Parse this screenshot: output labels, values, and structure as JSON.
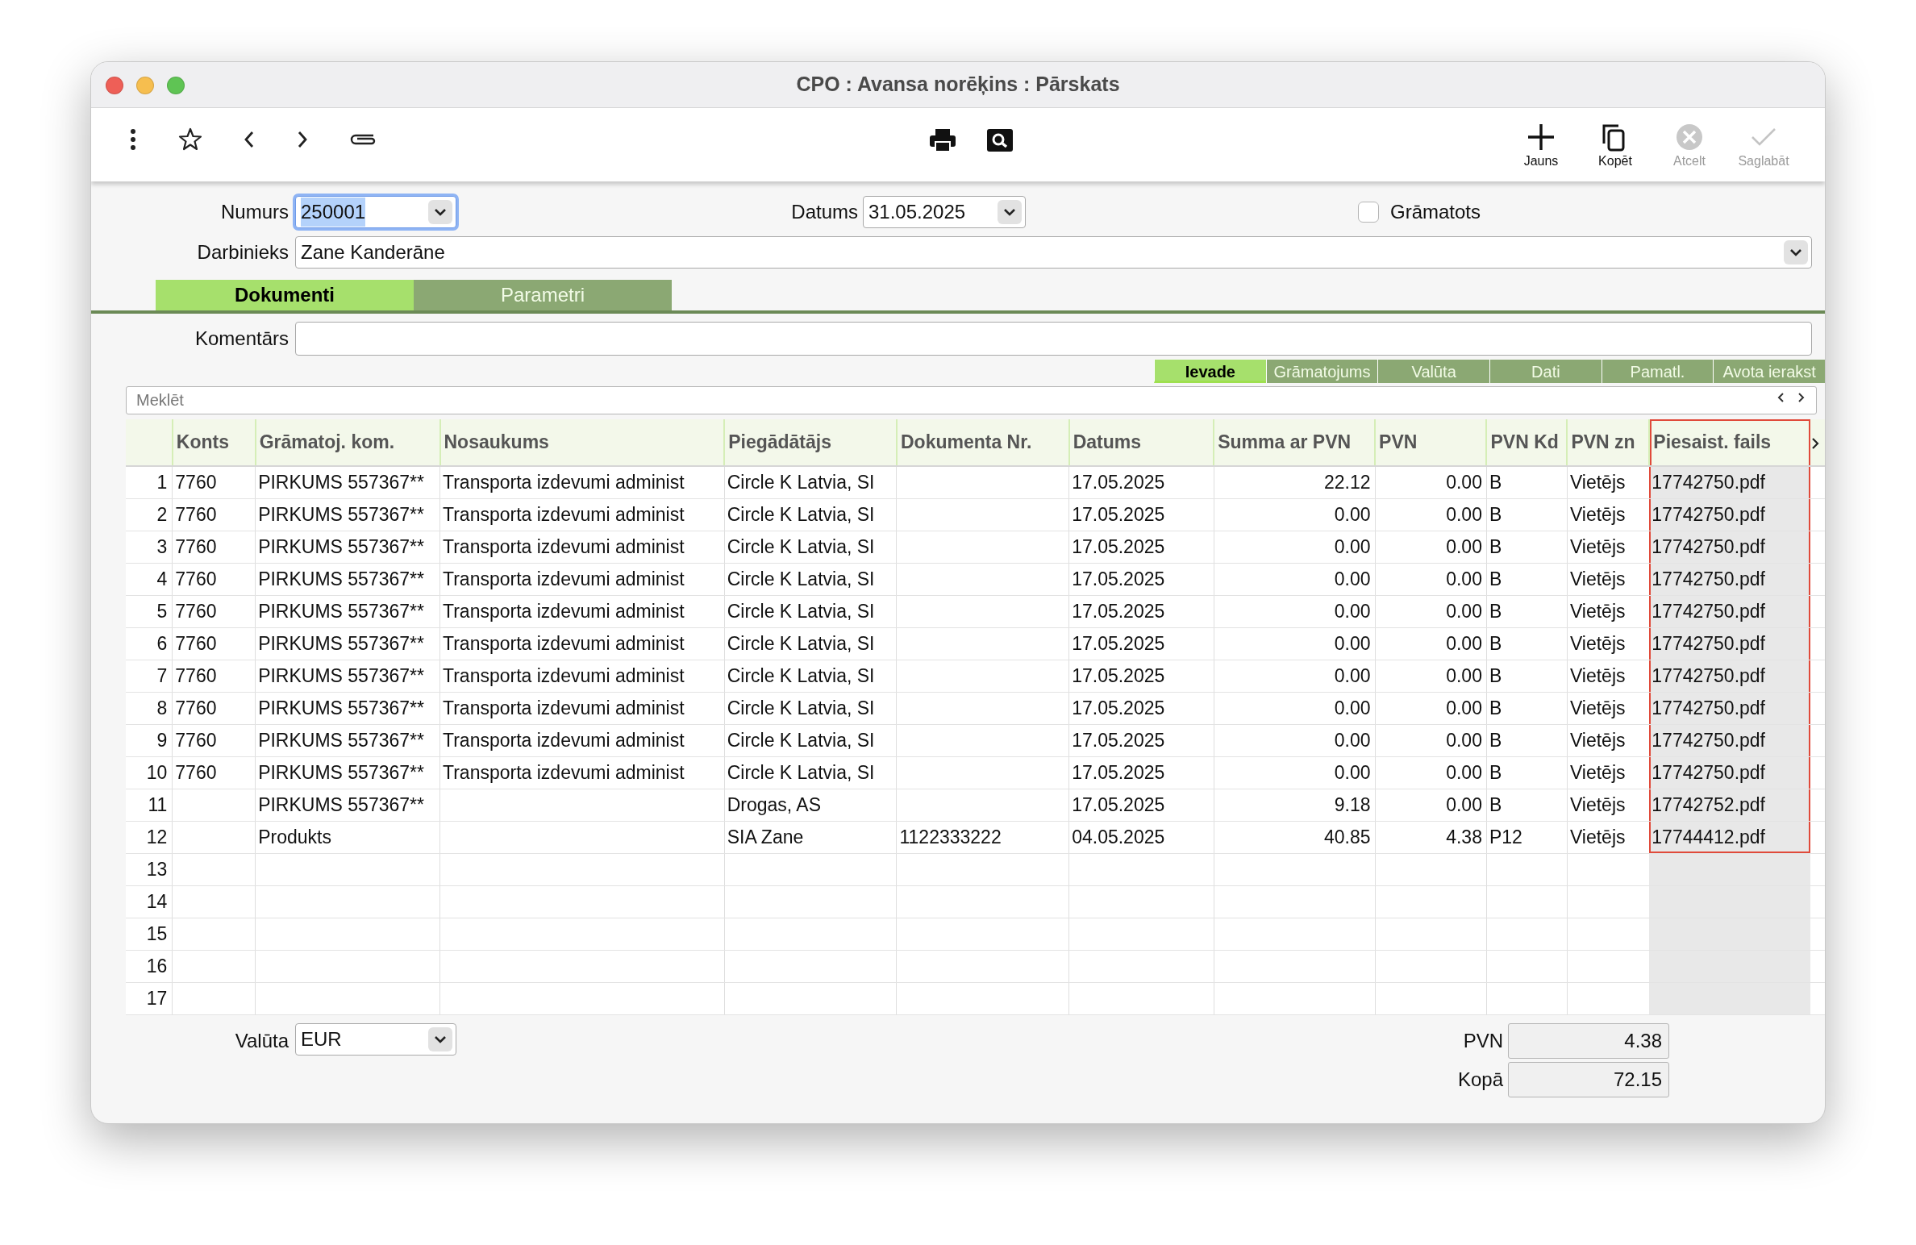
{
  "window": {
    "title": "CPO : Avansa norēķins : Pārskats"
  },
  "toolbar": {
    "buttons": [
      {
        "kind": "new",
        "label": "Jauns",
        "disabled": false
      },
      {
        "kind": "copy",
        "label": "Kopēt",
        "disabled": false
      },
      {
        "kind": "cancel",
        "label": "Atcelt",
        "disabled": true
      },
      {
        "kind": "save",
        "label": "Saglabāt",
        "disabled": true
      }
    ]
  },
  "form": {
    "number": {
      "label": "Numurs",
      "value": "250001",
      "focused": true
    },
    "date": {
      "label": "Datums",
      "value": "31.05.2025"
    },
    "posted": {
      "label": "Grāmatots",
      "checked": false
    },
    "employee": {
      "label": "Darbinieks",
      "value": "Zane Kanderāne"
    }
  },
  "tabs": [
    {
      "label": "Dokumenti",
      "selected": true
    },
    {
      "label": "Parametri",
      "selected": false
    }
  ],
  "comment": {
    "label": "Komentārs"
  },
  "subtabs": [
    {
      "label": "Ievade",
      "selected": true
    },
    {
      "label": "Grāmatojums",
      "selected": false
    },
    {
      "label": "Valūta",
      "selected": false
    },
    {
      "label": "Dati",
      "selected": false
    },
    {
      "label": "Pamatl.",
      "selected": false
    },
    {
      "label": "Avota ierakst",
      "selected": false
    }
  ],
  "search": {
    "placeholder": "Meklēt"
  },
  "table": {
    "columns": [
      {
        "label": "Konts",
        "highlighted": false
      },
      {
        "label": "Grāmatoj. kom.",
        "highlighted": false
      },
      {
        "label": "Nosaukums",
        "highlighted": false
      },
      {
        "label": "Piegādātājs",
        "highlighted": false
      },
      {
        "label": "Dokumenta Nr.",
        "highlighted": false
      },
      {
        "label": "Datums",
        "highlighted": false
      },
      {
        "label": "Summa ar PVN",
        "highlighted": false
      },
      {
        "label": "PVN",
        "highlighted": false
      },
      {
        "label": "PVN Kd",
        "highlighted": false
      },
      {
        "label": "PVN zn",
        "highlighted": false
      },
      {
        "label": "Piesaist. fails",
        "highlighted": true
      }
    ],
    "rows": [
      {
        "number": "1",
        "cells": [
          "7760",
          "PIRKUMS 557367**",
          "Transporta izdevumi administ",
          "Circle K Latvia, SI",
          null,
          "17.05.2025",
          "22.12",
          "0.00",
          "B",
          "Vietējs",
          "17742750.pdf"
        ]
      },
      {
        "number": "2",
        "cells": [
          "7760",
          "PIRKUMS 557367**",
          "Transporta izdevumi administ",
          "Circle K Latvia, SI",
          null,
          "17.05.2025",
          "0.00",
          "0.00",
          "B",
          "Vietējs",
          "17742750.pdf"
        ]
      },
      {
        "number": "3",
        "cells": [
          "7760",
          "PIRKUMS 557367**",
          "Transporta izdevumi administ",
          "Circle K Latvia, SI",
          null,
          "17.05.2025",
          "0.00",
          "0.00",
          "B",
          "Vietējs",
          "17742750.pdf"
        ]
      },
      {
        "number": "4",
        "cells": [
          "7760",
          "PIRKUMS 557367**",
          "Transporta izdevumi administ",
          "Circle K Latvia, SI",
          null,
          "17.05.2025",
          "0.00",
          "0.00",
          "B",
          "Vietējs",
          "17742750.pdf"
        ]
      },
      {
        "number": "5",
        "cells": [
          "7760",
          "PIRKUMS 557367**",
          "Transporta izdevumi administ",
          "Circle K Latvia, SI",
          null,
          "17.05.2025",
          "0.00",
          "0.00",
          "B",
          "Vietējs",
          "17742750.pdf"
        ]
      },
      {
        "number": "6",
        "cells": [
          "7760",
          "PIRKUMS 557367**",
          "Transporta izdevumi administ",
          "Circle K Latvia, SI",
          null,
          "17.05.2025",
          "0.00",
          "0.00",
          "B",
          "Vietējs",
          "17742750.pdf"
        ]
      },
      {
        "number": "7",
        "cells": [
          "7760",
          "PIRKUMS 557367**",
          "Transporta izdevumi administ",
          "Circle K Latvia, SI",
          null,
          "17.05.2025",
          "0.00",
          "0.00",
          "B",
          "Vietējs",
          "17742750.pdf"
        ]
      },
      {
        "number": "8",
        "cells": [
          "7760",
          "PIRKUMS 557367**",
          "Transporta izdevumi administ",
          "Circle K Latvia, SI",
          null,
          "17.05.2025",
          "0.00",
          "0.00",
          "B",
          "Vietējs",
          "17742750.pdf"
        ]
      },
      {
        "number": "9",
        "cells": [
          "7760",
          "PIRKUMS 557367**",
          "Transporta izdevumi administ",
          "Circle K Latvia, SI",
          null,
          "17.05.2025",
          "0.00",
          "0.00",
          "B",
          "Vietējs",
          "17742750.pdf"
        ]
      },
      {
        "number": "10",
        "cells": [
          "7760",
          "PIRKUMS 557367**",
          "Transporta izdevumi administ",
          "Circle K Latvia, SI",
          null,
          "17.05.2025",
          "0.00",
          "0.00",
          "B",
          "Vietējs",
          "17742750.pdf"
        ]
      },
      {
        "number": "11",
        "cells": [
          null,
          "PIRKUMS 557367**",
          null,
          "Drogas, AS",
          null,
          "17.05.2025",
          "9.18",
          "0.00",
          "B",
          "Vietējs",
          "17742752.pdf"
        ]
      },
      {
        "number": "12",
        "cells": [
          null,
          "Produkts",
          null,
          "SIA Zane",
          "1122333222",
          "04.05.2025",
          "40.85",
          "4.38",
          "P12",
          "Vietējs",
          "17744412.pdf"
        ]
      },
      {
        "number": "13"
      },
      {
        "number": "14"
      },
      {
        "number": "15"
      },
      {
        "number": "16"
      },
      {
        "number": "17"
      }
    ]
  },
  "footer": {
    "currency": {
      "label": "Valūta",
      "value": "EUR"
    },
    "vat": {
      "label": "PVN",
      "value": "4.38"
    },
    "total": {
      "label": "Kopā",
      "value": "72.15"
    }
  }
}
